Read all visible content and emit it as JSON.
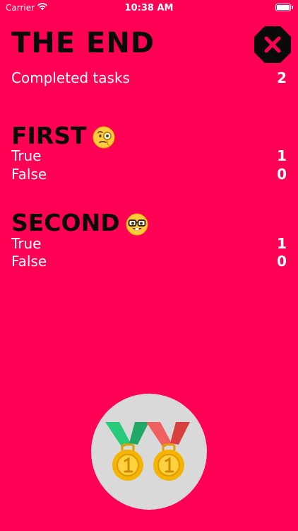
{
  "status_bar": {
    "carrier": "Carrier",
    "time": "10:38 AM"
  },
  "header": {
    "title": "THE END"
  },
  "summary": {
    "label": "Completed tasks",
    "value": "2"
  },
  "sections": [
    {
      "title": "FIRST",
      "emoji": "monocle-face-icon",
      "rows": [
        {
          "label": "True",
          "value": "1"
        },
        {
          "label": "False",
          "value": "0"
        }
      ]
    },
    {
      "title": "SECOND",
      "emoji": "nerd-face-icon",
      "rows": [
        {
          "label": "True",
          "value": "1"
        },
        {
          "label": "False",
          "value": "0"
        }
      ]
    }
  ],
  "colors": {
    "background": "#FF0055",
    "title": "#0A0A0A",
    "text": "#FFFFFF",
    "close_button": "#0A0A0A",
    "medal_circle": "#D9D9D9"
  }
}
